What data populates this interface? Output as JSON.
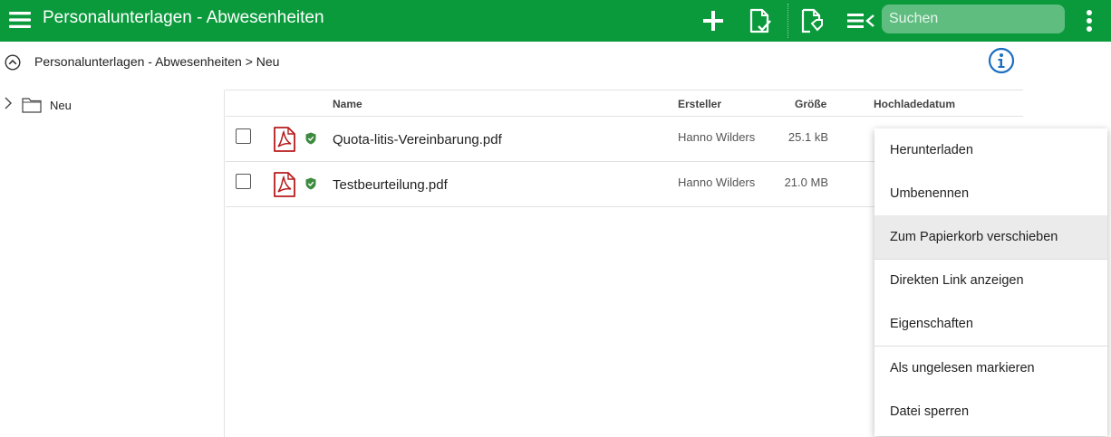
{
  "header": {
    "title": "Personalunterlagen - Abwesenheiten",
    "search_placeholder": "Suchen",
    "accent_color": "#0a9a3c",
    "icons": [
      "menu-icon",
      "plus-icon",
      "document-check-icon",
      "document-tag-icon",
      "list-view-icon",
      "more-vertical-icon"
    ]
  },
  "breadcrumb": {
    "path": "Personalunterlagen - Abwesenheiten > Neu"
  },
  "tree": {
    "items": [
      {
        "label": "Neu"
      }
    ]
  },
  "table": {
    "columns": {
      "name": "Name",
      "creator": "Ersteller",
      "size": "Größe",
      "upload_date": "Hochladedatum"
    },
    "rows": [
      {
        "name": "Quota-litis-Vereinbarung.pdf",
        "creator": "Hanno Wilders",
        "size": "25.1 kB"
      },
      {
        "name": "Testbeurteilung.pdf",
        "creator": "Hanno Wilders",
        "size": "21.0 MB"
      }
    ]
  },
  "context_menu": {
    "items": [
      {
        "label": "Herunterladen"
      },
      {
        "label": "Umbenennen"
      },
      {
        "label": "Zum Papierkorb verschieben"
      },
      {
        "label": "Direkten Link anzeigen"
      },
      {
        "label": "Eigenschaften"
      },
      {
        "label": "Als ungelesen markieren"
      },
      {
        "label": "Datei sperren"
      }
    ],
    "highlighted_color": "#ebebeb"
  }
}
